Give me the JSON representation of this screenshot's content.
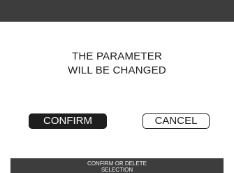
{
  "dialog": {
    "message_line1": "THE PARAMETER",
    "message_line2": "WILL BE CHANGED",
    "confirm_label": "CONFIRM",
    "cancel_label": "CANCEL"
  },
  "footer": {
    "hint": "CONFIRM OR DELETE SELECTION"
  },
  "colors": {
    "bar": "#3d3d3d",
    "selected_button": "#1e1e1e",
    "background": "#ffffff"
  }
}
